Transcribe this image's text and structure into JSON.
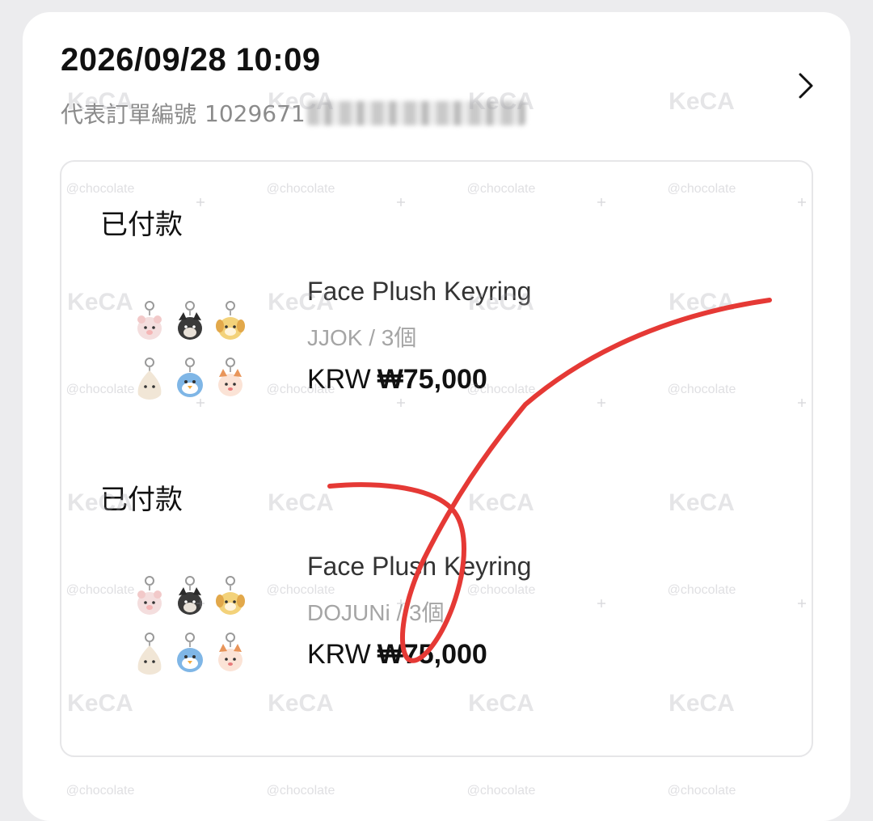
{
  "header": {
    "datetime": "2026/09/28 10:09",
    "order_label": "代表訂單編號",
    "order_number_visible": "1029671"
  },
  "items": [
    {
      "status": "已付款",
      "name": "Face Plush Keyring",
      "option": "JJOK / 3個",
      "currency": "KRW",
      "price": "₩75,000"
    },
    {
      "status": "已付款",
      "name": "Face Plush Keyring",
      "option": "DOJUNi / 3個",
      "currency": "KRW",
      "price": "₩75,000"
    }
  ],
  "watermarks": {
    "logo": "KeCA",
    "handle": "@chocolate"
  },
  "icons": {
    "chevron": "chevron-right-icon"
  },
  "colors": {
    "background": "#ececee",
    "card": "#ffffff",
    "annotation": "#e53935",
    "muted_text": "#8b8b8b"
  }
}
